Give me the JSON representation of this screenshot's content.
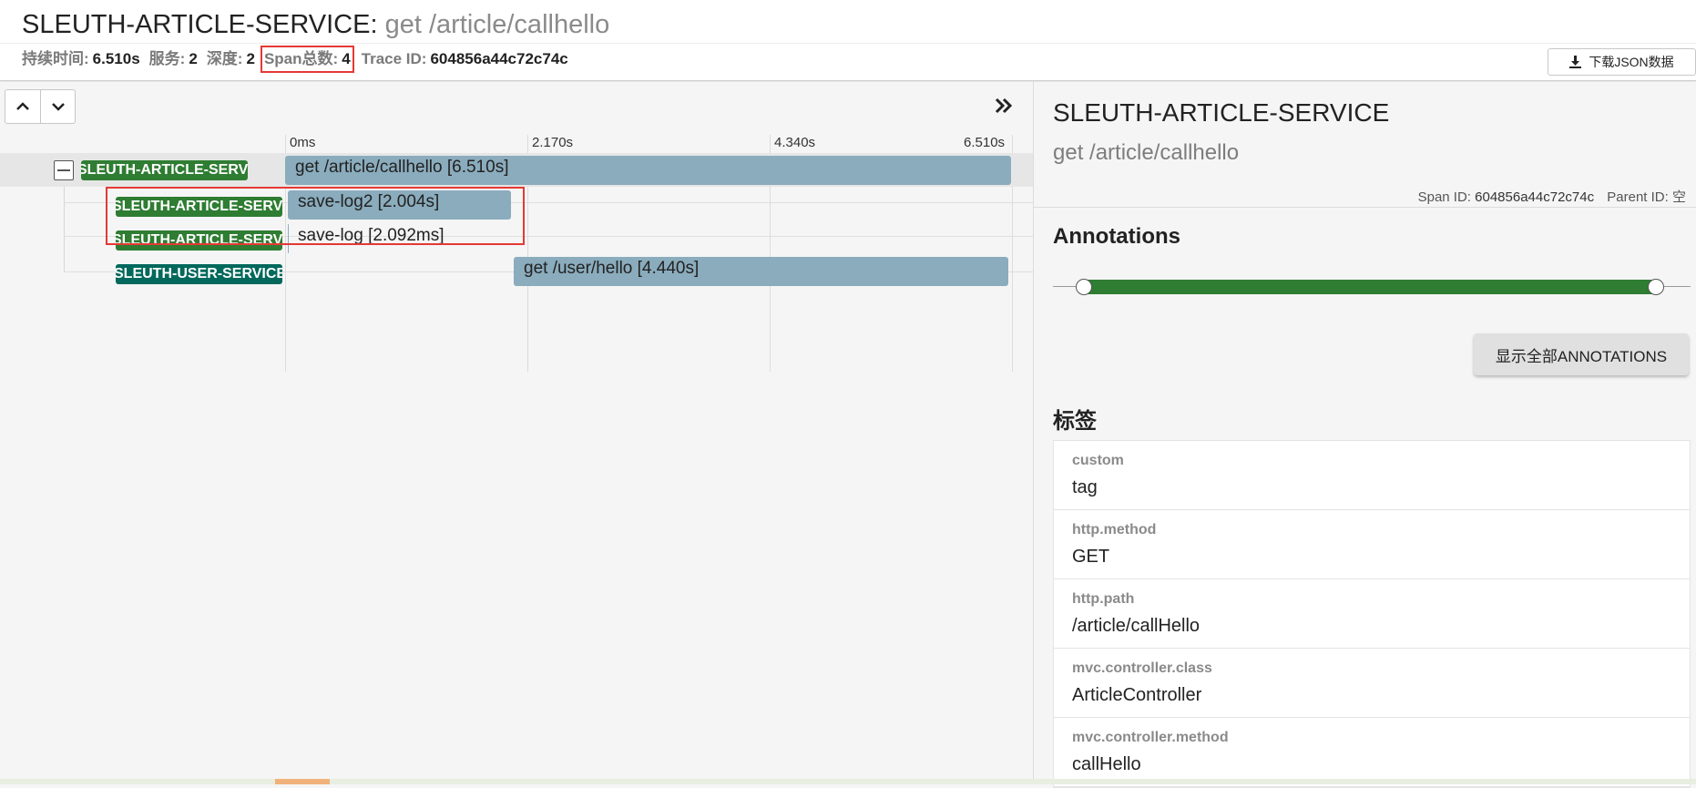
{
  "header": {
    "service": "SLEUTH-ARTICLE-SERVICE",
    "separator": ": ",
    "span_name": "get /article/callhello",
    "stats": {
      "duration_label": "持续时间:",
      "duration_value": "6.510s",
      "services_label": "服务:",
      "services_value": "2",
      "depth_label": "深度:",
      "depth_value": "2",
      "span_total_label": "Span总数:",
      "span_total_value": "4",
      "trace_id_label": "Trace ID:",
      "trace_id_value": "604856a44c72c74c"
    },
    "download_label": "下载JSON数据"
  },
  "timeline": {
    "ticks": [
      "0ms",
      "2.170s",
      "4.340s",
      "6.510s"
    ],
    "rows": [
      {
        "service": "SLEUTH-ARTICLE-SERVICE",
        "label": "get /article/callhello [6.510s]"
      },
      {
        "service": "SLEUTH-ARTICLE-SERVICE",
        "label": "save-log2 [2.004s]"
      },
      {
        "service": "SLEUTH-ARTICLE-SERVICE",
        "label": "save-log [2.092ms]"
      },
      {
        "service": "SLEUTH-USER-SERVICE",
        "label": "get /user/hello [4.440s]"
      }
    ]
  },
  "detail": {
    "service": "SLEUTH-ARTICLE-SERVICE",
    "span_name": "get /article/callhello",
    "span_id_label": "Span ID:",
    "span_id_value": "604856a44c72c74c",
    "parent_id_label": "Parent ID:",
    "parent_id_value": "空",
    "annotations_title": "Annotations",
    "show_all_label": "显示全部ANNOTATIONS",
    "tags_title": "标签",
    "tags": [
      {
        "key": "custom",
        "value": "tag"
      },
      {
        "key": "http.method",
        "value": "GET"
      },
      {
        "key": "http.path",
        "value": "/article/callHello"
      },
      {
        "key": "mvc.controller.class",
        "value": "ArticleController"
      },
      {
        "key": "mvc.controller.method",
        "value": "callHello"
      }
    ]
  },
  "colors": {
    "service_badge": "#2e7d32",
    "user_service_badge": "#00695c",
    "span_bar": "#8aacbd",
    "highlight": "#e53935"
  }
}
